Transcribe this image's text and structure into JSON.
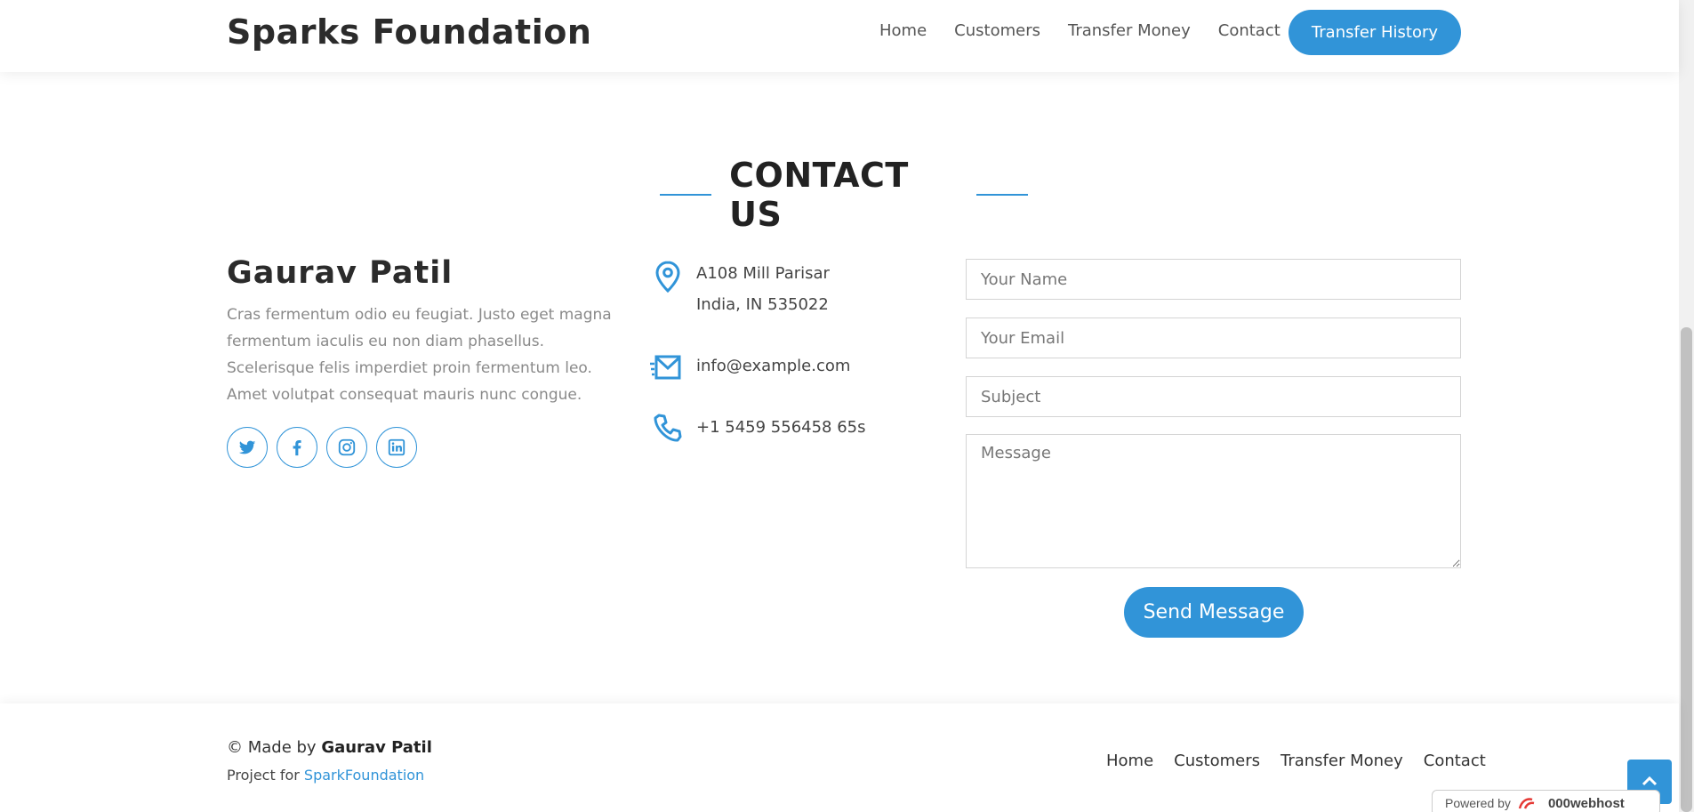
{
  "header": {
    "logo": "Sparks Foundation",
    "nav": [
      "Home",
      "Customers",
      "Transfer Money",
      "Contact"
    ],
    "cta": "Transfer History"
  },
  "section": {
    "title": "CONTACT US"
  },
  "profile": {
    "name": "Gaurav Patil",
    "description": "Cras fermentum odio eu feugiat. Justo eget magna fermentum iaculis eu non diam phasellus. Scelerisque felis imperdiet proin fermentum leo. Amet volutpat consequat mauris nunc congue.",
    "social": [
      "twitter-icon",
      "facebook-icon",
      "instagram-icon",
      "linkedin-icon"
    ]
  },
  "contact_info": {
    "address_line1": "A108 Mill Parisar",
    "address_line2": "India, IN 535022",
    "email": "info@example.com",
    "phone": "+1 5459 556458 65s"
  },
  "form": {
    "name_placeholder": "Your Name",
    "email_placeholder": "Your Email",
    "subject_placeholder": "Subject",
    "message_placeholder": "Message",
    "submit": "Send Message"
  },
  "footer": {
    "made_by_prefix": "© Made by ",
    "made_by_name": "Gaurav Patil",
    "project_prefix": "Project for ",
    "project_link": "SparkFoundation",
    "nav": [
      "Home",
      "Customers",
      "Transfer Money",
      "Contact"
    ],
    "powered_prefix": "Powered by",
    "powered_brand": "000webhost"
  },
  "colors": {
    "accent": "#3194d8",
    "heading": "#222222",
    "muted_text": "#8a8a8a"
  }
}
